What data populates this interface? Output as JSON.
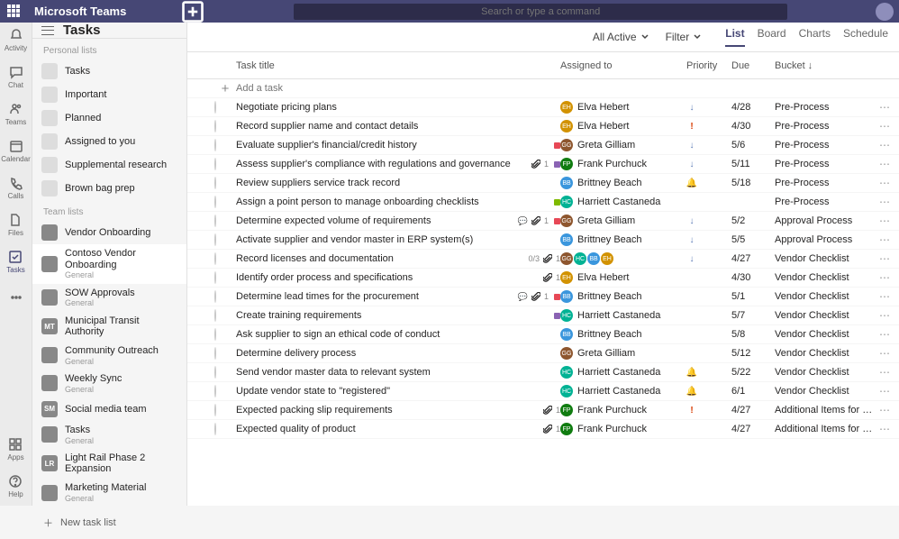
{
  "titlebar": {
    "app_name": "Microsoft Teams",
    "search_placeholder": "Search or type a command"
  },
  "rail": {
    "items": [
      {
        "id": "activity",
        "label": "Activity"
      },
      {
        "id": "chat",
        "label": "Chat"
      },
      {
        "id": "teams",
        "label": "Teams"
      },
      {
        "id": "calendar",
        "label": "Calendar"
      },
      {
        "id": "calls",
        "label": "Calls"
      },
      {
        "id": "files",
        "label": "Files"
      },
      {
        "id": "tasks",
        "label": "Tasks"
      }
    ],
    "bottom": [
      {
        "id": "apps",
        "label": "Apps"
      },
      {
        "id": "help",
        "label": "Help"
      }
    ]
  },
  "sidebar": {
    "title": "Tasks",
    "section_personal": "Personal lists",
    "personal": [
      {
        "label": "Tasks"
      },
      {
        "label": "Important"
      },
      {
        "label": "Planned"
      },
      {
        "label": "Assigned to you"
      },
      {
        "label": "Supplemental research"
      },
      {
        "label": "Brown bag prep"
      }
    ],
    "section_team": "Team lists",
    "team": [
      {
        "initials": "",
        "label": "Vendor Onboarding",
        "sub": ""
      },
      {
        "initials": "",
        "label": "Contoso Vendor Onboarding",
        "sub": "General"
      },
      {
        "initials": "",
        "label": "SOW Approvals",
        "sub": "General"
      },
      {
        "initials": "MT",
        "label": "Municipal Transit Authority",
        "sub": ""
      },
      {
        "initials": "",
        "label": "Community Outreach",
        "sub": "General"
      },
      {
        "initials": "",
        "label": "Weekly Sync",
        "sub": "General"
      },
      {
        "initials": "SM",
        "label": "Social media team",
        "sub": ""
      },
      {
        "initials": "",
        "label": "Tasks",
        "sub": "General"
      },
      {
        "initials": "LR",
        "label": "Light Rail Phase 2 Expansion",
        "sub": ""
      },
      {
        "initials": "",
        "label": "Marketing Material",
        "sub": "General"
      }
    ],
    "new_list": "New task list"
  },
  "toolbar": {
    "filter_all": "All Active",
    "filter": "Filter",
    "views": [
      "List",
      "Board",
      "Charts",
      "Schedule"
    ]
  },
  "table": {
    "columns": {
      "title": "Task title",
      "assigned": "Assigned to",
      "priority": "Priority",
      "due": "Due",
      "bucket": "Bucket ↓"
    },
    "add_placeholder": "Add a task",
    "rows": [
      {
        "title": "Negotiate pricing plans",
        "assignee": {
          "init": "EH",
          "name": "Elva Hebert",
          "cls": "c-eh"
        },
        "priority": "low",
        "due": "4/28",
        "bucket": "Pre-Process",
        "tags": []
      },
      {
        "title": "Record supplier name and contact details",
        "assignee": {
          "init": "EH",
          "name": "Elva Hebert",
          "cls": "c-eh"
        },
        "priority": "urgent",
        "due": "4/30",
        "bucket": "Pre-Process",
        "tags": []
      },
      {
        "title": "Evaluate supplier's financial/credit history",
        "assignee": {
          "init": "GG",
          "name": "Greta Gilliam",
          "cls": "c-gg"
        },
        "priority": "low",
        "due": "5/6",
        "bucket": "Pre-Process",
        "tags": [
          "red"
        ]
      },
      {
        "title": "Assess supplier's compliance with regulations and governance",
        "assignee": {
          "init": "FP",
          "name": "Frank Purchuck",
          "cls": "c-fp"
        },
        "priority": "low",
        "due": "5/11",
        "bucket": "Pre-Process",
        "tags": [
          "purple"
        ],
        "attach": "1"
      },
      {
        "title": "Review suppliers service track record",
        "assignee": {
          "init": "BB",
          "name": "Brittney Beach",
          "cls": "c-bb"
        },
        "priority": "alert",
        "due": "5/18",
        "bucket": "Pre-Process",
        "tags": []
      },
      {
        "title": "Assign a point person to manage onboarding checklists",
        "assignee": {
          "init": "HC",
          "name": "Harriett Castaneda",
          "cls": "c-hc"
        },
        "priority": "",
        "due": "",
        "bucket": "Pre-Process",
        "tags": [
          "green"
        ]
      },
      {
        "title": "Determine expected volume of requirements",
        "assignee": {
          "init": "GG",
          "name": "Greta Gilliam",
          "cls": "c-gg"
        },
        "priority": "low",
        "due": "5/2",
        "bucket": "Approval Process",
        "tags": [
          "red"
        ],
        "attach": "1",
        "comments": true
      },
      {
        "title": "Activate supplier and vendor master in ERP system(s)",
        "assignee": {
          "init": "BB",
          "name": "Brittney Beach",
          "cls": "c-bb"
        },
        "priority": "low",
        "due": "5/5",
        "bucket": "Approval Process",
        "tags": []
      },
      {
        "title": "Record licenses and documentation",
        "assignee": {
          "init": "GG",
          "name": "",
          "cls": "c-gg",
          "multi": true
        },
        "priority": "low",
        "due": "4/27",
        "bucket": "Vendor Checklist",
        "tags": [],
        "attach": "1",
        "checklist": "0/3"
      },
      {
        "title": "Identify order process and specifications",
        "assignee": {
          "init": "EH",
          "name": "Elva Hebert",
          "cls": "c-eh"
        },
        "priority": "",
        "due": "4/30",
        "bucket": "Vendor Checklist",
        "tags": [],
        "attach": "1"
      },
      {
        "title": "Determine lead times for the procurement",
        "assignee": {
          "init": "BB",
          "name": "Brittney Beach",
          "cls": "c-bb"
        },
        "priority": "",
        "due": "5/1",
        "bucket": "Vendor Checklist",
        "tags": [
          "red"
        ],
        "attach": "1",
        "comments": true
      },
      {
        "title": "Create training requirements",
        "assignee": {
          "init": "HC",
          "name": "Harriett Castaneda",
          "cls": "c-hc"
        },
        "priority": "",
        "due": "5/7",
        "bucket": "Vendor Checklist",
        "tags": [
          "purple"
        ]
      },
      {
        "title": "Ask supplier to sign an ethical code of conduct",
        "assignee": {
          "init": "BB",
          "name": "Brittney Beach",
          "cls": "c-bb"
        },
        "priority": "",
        "due": "5/8",
        "bucket": "Vendor Checklist",
        "tags": []
      },
      {
        "title": "Determine delivery process",
        "assignee": {
          "init": "GG",
          "name": "Greta Gilliam",
          "cls": "c-gg"
        },
        "priority": "",
        "due": "5/12",
        "bucket": "Vendor Checklist",
        "tags": []
      },
      {
        "title": "Send vendor master data to relevant system",
        "assignee": {
          "init": "HC",
          "name": "Harriett Castaneda",
          "cls": "c-hc"
        },
        "priority": "alert",
        "due": "5/22",
        "bucket": "Vendor Checklist",
        "tags": []
      },
      {
        "title": "Update vendor state to \"registered\"",
        "assignee": {
          "init": "HC",
          "name": "Harriett Castaneda",
          "cls": "c-hc"
        },
        "priority": "alert",
        "due": "6/1",
        "bucket": "Vendor Checklist",
        "tags": []
      },
      {
        "title": "Expected packing slip requirements",
        "assignee": {
          "init": "FP",
          "name": "Frank Purchuck",
          "cls": "c-fp"
        },
        "priority": "urgent",
        "due": "4/27",
        "bucket": "Additional Items for Strate…",
        "tags": [],
        "attach": "1"
      },
      {
        "title": "Expected quality of product",
        "assignee": {
          "init": "FP",
          "name": "Frank Purchuck",
          "cls": "c-fp"
        },
        "priority": "",
        "due": "4/27",
        "bucket": "Additional Items for Strate…",
        "tags": [],
        "attach": "1"
      }
    ]
  }
}
